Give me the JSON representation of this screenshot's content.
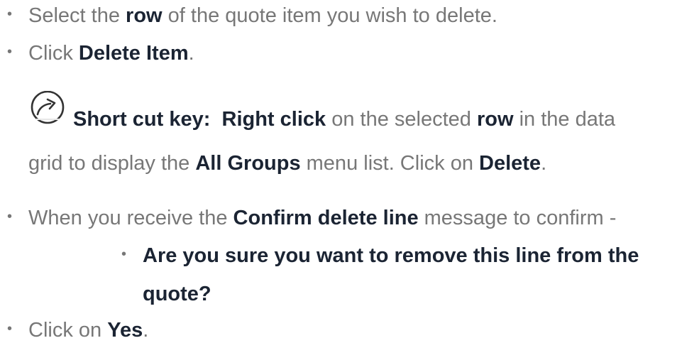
{
  "steps": {
    "step1": {
      "pre": "Select the ",
      "bold": "row",
      "post": " of the quote item you wish to delete."
    },
    "step2": {
      "pre": "Click ",
      "bold": "Delete Item",
      "post": "."
    },
    "shortcut": {
      "icon": "shortcut-arrow-icon",
      "label": "Short cut key:",
      "action": "Right click",
      "text1": " on the selected ",
      "row": "row",
      "text2": " in the data",
      "line2_pre": "grid to display the ",
      "menu": "All Groups",
      "line2_mid": " menu list. Click on ",
      "delete": "Delete",
      "line2_post": "."
    },
    "step3": {
      "pre": "When you receive the ",
      "bold": "Confirm delete line",
      "post": " message to confirm -"
    },
    "sub": {
      "line1": "Are you sure you want to remove this line from the",
      "line2": "quote?"
    },
    "step4": {
      "pre": "Click on ",
      "bold": "Yes",
      "post": "."
    }
  },
  "colors": {
    "text": "#777777",
    "emphasis": "#1b2433"
  }
}
